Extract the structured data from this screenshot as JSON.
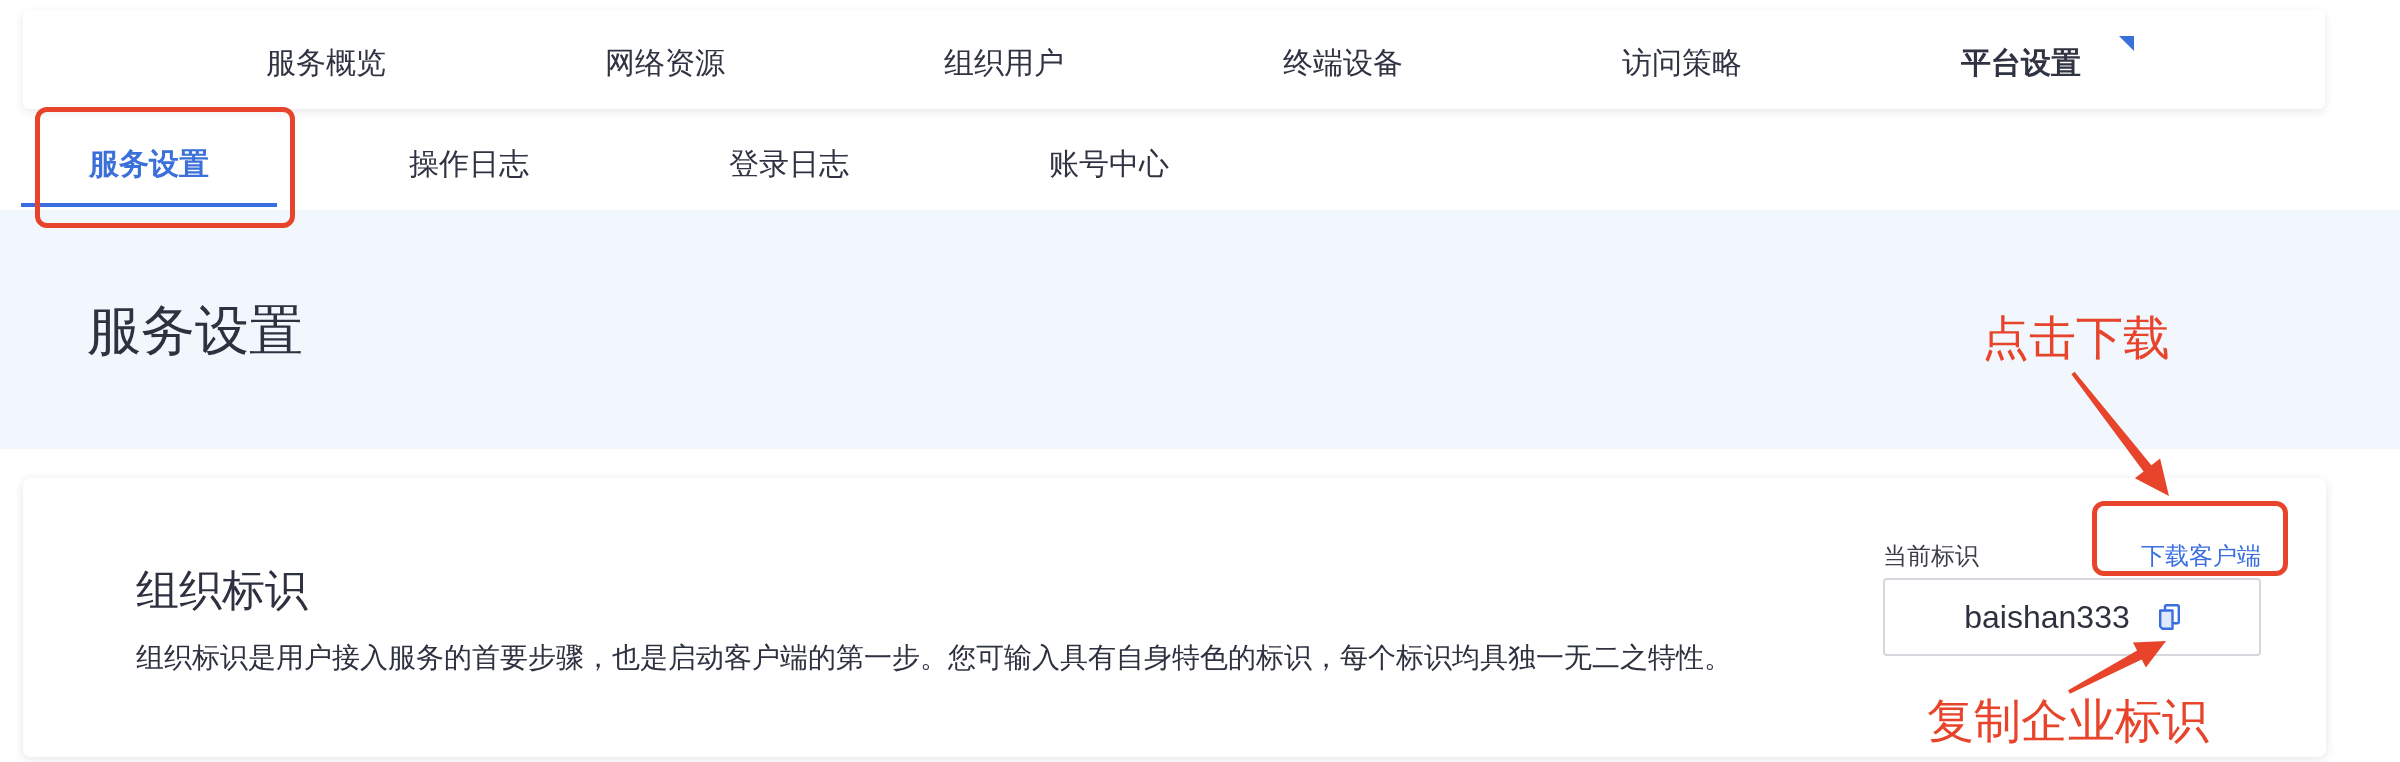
{
  "nav": [
    {
      "label": "服务概览",
      "selected": false
    },
    {
      "label": "网络资源",
      "selected": false
    },
    {
      "label": "组织用户",
      "selected": false
    },
    {
      "label": "终端设备",
      "selected": false
    },
    {
      "label": "访问策略",
      "selected": false
    },
    {
      "label": "平台设置",
      "selected": true
    }
  ],
  "subtabs": [
    {
      "label": "服务设置",
      "selected": true
    },
    {
      "label": "操作日志",
      "selected": false
    },
    {
      "label": "登录日志",
      "selected": false
    },
    {
      "label": "账号中心",
      "selected": false
    }
  ],
  "page_title": "服务设置",
  "org_identifier": {
    "title": "组织标识",
    "description": "组织标识是用户接入服务的首要步骤，也是启动客户端的第一步。您可输入具有自身特色的标识，每个标识均具独一无二之特性。",
    "current_label": "当前标识",
    "download_link": "下载客户端",
    "value": "baishan333"
  },
  "annotations": [
    {
      "text": "点击下载"
    },
    {
      "text": "复制企业标识"
    }
  ]
}
